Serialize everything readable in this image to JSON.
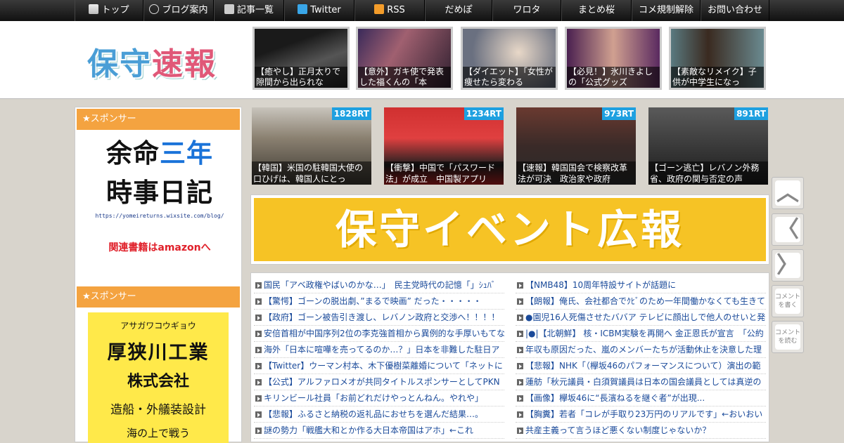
{
  "nav": {
    "items": [
      {
        "label": "トップ",
        "icon": "home-icon"
      },
      {
        "label": "ブログ案内",
        "icon": "info-icon"
      },
      {
        "label": "記事一覧",
        "icon": "list-icon"
      },
      {
        "label": "Twitter",
        "icon": "twitter-icon"
      },
      {
        "label": "RSS",
        "icon": "rss-icon"
      },
      {
        "label": "だめぽ"
      },
      {
        "label": "ワロタ"
      },
      {
        "label": "まとめ桜"
      },
      {
        "label": "コメ規制解除"
      },
      {
        "label": "お問い合わせ"
      }
    ]
  },
  "header": {
    "logo_part1": "保守",
    "logo_part2": "速報"
  },
  "top_thumbs": [
    {
      "caption": "【癒やし】正月太りで隙間から出られな"
    },
    {
      "caption": "【意外】ガキ使で発表した福くんの「本"
    },
    {
      "caption": "【ダイエット】「女性が痩せたら変わる"
    },
    {
      "caption": "【必見！】氷川きよしの「公式グッズ"
    },
    {
      "caption": "【素敵なリメイク】子供が中学生になっ"
    }
  ],
  "sidebar": {
    "sponsor_label_1": "★スポンサー",
    "ad1": {
      "line1a": "余命",
      "line1b": "三年",
      "line2": "時事日記",
      "url": "https://yomeireturns.wixsite.com/blog/",
      "amazon": "関連書籍はamazonへ"
    },
    "sponsor_label_2": "★スポンサー",
    "ad2": {
      "kana": "アサガワコウギョウ",
      "company": "厚狭川工業",
      "corp": "株式会社",
      "desc": "造船・外艤装設計",
      "desc2": "海の上で戦う"
    }
  },
  "rt_items": [
    {
      "badge": "1828RT",
      "caption": "【韓国】米国の駐韓国大使の口ひげは、韓国人にとっ"
    },
    {
      "badge": "1234RT",
      "caption": "【衝撃】中国で「パスワード法」が成立　中国製アプリ"
    },
    {
      "badge": "973RT",
      "caption": "【速報】韓国国会で検察改革法が可決　政治家や政府"
    },
    {
      "badge": "891RT",
      "caption": "【ゴーン逃亡】レバノン外務省、政府の関与否定の声"
    }
  ],
  "banner": {
    "text": "保守イベント広報"
  },
  "articles_left": [
    "国民「アベ政権やばいのかな…」　民主党時代の記憶「」ｼｭﾊﾞ",
    "【驚愕】ゴーンの脱出劇、”まるで映画” だった・・・・・",
    "【政府】ゴーン被告引き渡し、レバノン政府と交渉へ！！！！",
    "安倍首相が中国序列2位の李克強首相から異例的な手厚いもてな",
    "海外「日本に喧嘩を売ってるのか…？」日本を非難した駐日ア",
    "【Twitter】ウーマン村本、木下優樹菜離婚について「ネットに",
    "【公式】アルファロメオが共同タイトルスポンサーとしてPKN",
    "キリンビール社員「お前どれだけやっとんねん。やれや」",
    "【悲報】ふるさと納税の返礼品におせちを選んだ結果…。",
    "謎の勢力「戦艦大和とか作る大日本帝国はアホ」←これ"
  ],
  "articles_right": [
    "【NMB48】10周年特設サイトが話題に",
    "【朗報】俺氏、会社都合でｸﾋﾞのため一年間働かなくても生きて",
    "●園児16人死傷させたババア テレビに顔出しで他人のせいと発",
    "|●|【北朝鮮】 核・ICBM実験を再開へ 金正恩氏が宣言　「公約",
    "年収も原因だった、嵐のメンバーたちが活動休止を決意した理",
    "【悲報】NHK「（欅坂46のパフォーマンスについて）演出の範",
    "蓮舫「秋元議員・白須賀議員は日本の国会議員としては真逆の",
    "【画像】欅坂46に“長濱ねるを継ぐ者”が出現...",
    "【胸糞】若者「コレが手取り23万円のリアルです」←おいおい",
    "共産主義って言うほど悪くない制度じゃないか？"
  ],
  "side_buttons": [
    {
      "icon": "chevron-up-icon",
      "glyph": "︿"
    },
    {
      "icon": "chevron-left-icon",
      "glyph": "〈"
    },
    {
      "icon": "chevron-right-icon",
      "glyph": "〉"
    },
    {
      "label": "コメントを書く"
    },
    {
      "label": "コメントを読む"
    }
  ]
}
